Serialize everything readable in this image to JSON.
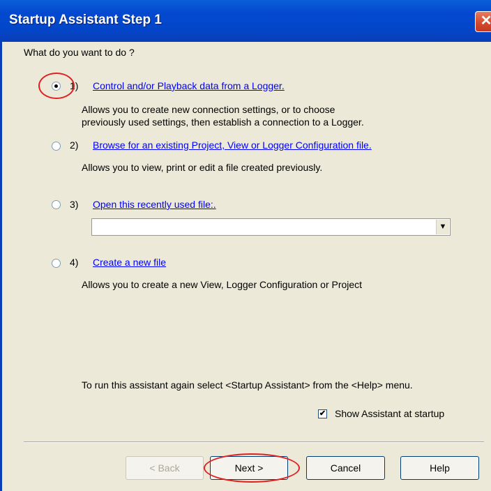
{
  "window": {
    "title": "Startup Assistant Step 1",
    "close_glyph": "✕"
  },
  "question": "What do you want to do ?",
  "options": [
    {
      "number": "1)",
      "link": "Control and/or Playback data from a Logger.",
      "description": [
        "Allows you to create new connection settings, or to choose",
        "previously used settings, then establish a connection to a Logger."
      ],
      "selected": true
    },
    {
      "number": "2)",
      "link": "Browse for an existing Project, View or Logger Configuration file.",
      "description": [
        "Allows you to view, print or edit a file created previously."
      ],
      "selected": false
    },
    {
      "number": "3)",
      "link": "Open this recently used file:.",
      "recent_file_value": "",
      "selected": false
    },
    {
      "number": "4)",
      "link": "Create a new file",
      "description": [
        "Allows you to create a new View, Logger Configuration or Project"
      ],
      "selected": false
    }
  ],
  "hint": "To run this assistant again select <Startup Assistant> from the <Help> menu.",
  "show_at_startup": {
    "label": "Show Assistant at startup",
    "checked": true,
    "check_glyph": "✔"
  },
  "buttons": {
    "back": "< Back",
    "next": "Next >",
    "cancel": "Cancel",
    "help": "Help"
  },
  "combo_arrow_glyph": "▼",
  "colors": {
    "annotation": "#E02020",
    "link": "#0000FF",
    "titlebar": "#0349D0"
  }
}
